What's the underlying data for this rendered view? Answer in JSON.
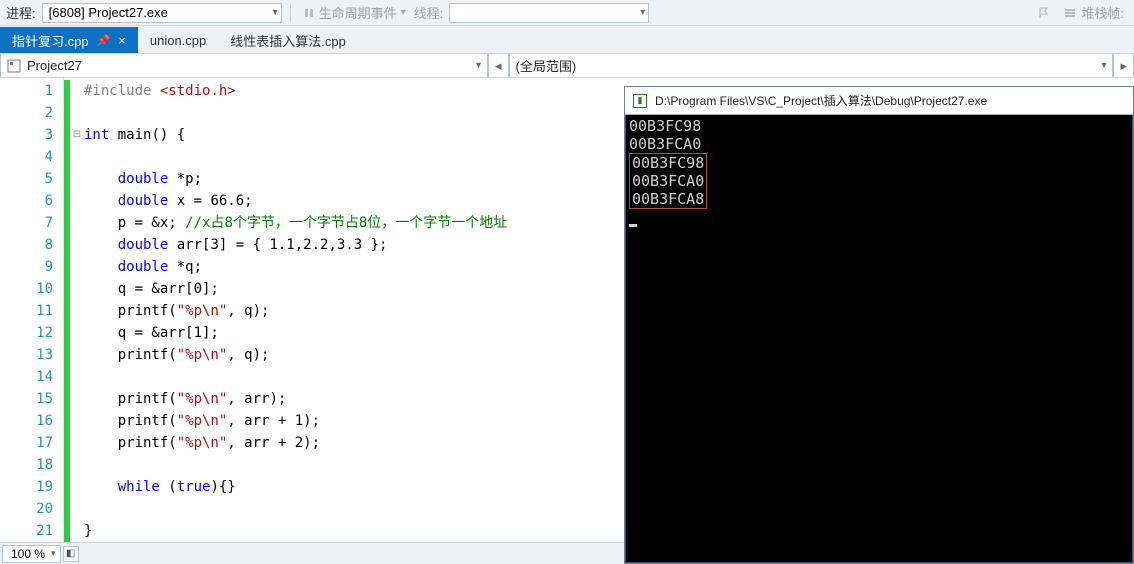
{
  "toolbar": {
    "process_label": "进程:",
    "process_value": "[6808] Project27.exe",
    "lifecycle": "生命周期事件",
    "thread_label": "线程:",
    "stack_label": "堆栈帧:"
  },
  "tabs": [
    {
      "label": "指针复习.cpp",
      "active": true
    },
    {
      "label": "union.cpp",
      "active": false
    },
    {
      "label": "线性表插入算法.cpp",
      "active": false
    }
  ],
  "crumb": {
    "left": "Project27",
    "right": "(全局范围)"
  },
  "code": {
    "lines": [
      {
        "n": 1,
        "html": "<span class='pre'>#include</span> <span class='hdr'>&lt;stdio.h&gt;</span>"
      },
      {
        "n": 2,
        "html": ""
      },
      {
        "n": 3,
        "html": "<span class='kw'>int</span> main() {",
        "fold": "⊟"
      },
      {
        "n": 4,
        "html": ""
      },
      {
        "n": 5,
        "html": "    <span class='kw'>double</span> *p;"
      },
      {
        "n": 6,
        "html": "    <span class='kw'>double</span> x = 66.6;"
      },
      {
        "n": 7,
        "html": "    p = &amp;x; <span class='cmt'>//x占8个字节，一个字节占8位，一个字节一个地址</span>"
      },
      {
        "n": 8,
        "html": "    <span class='kw'>double</span> arr[3] = { 1.1,2.2,3.3 };"
      },
      {
        "n": 9,
        "html": "    <span class='kw'>double</span> *q;"
      },
      {
        "n": 10,
        "html": "    q = &amp;arr[0];"
      },
      {
        "n": 11,
        "html": "    printf(<span class='hdr'>\"%p\\n\"</span>, q);"
      },
      {
        "n": 12,
        "html": "    q = &amp;arr[1];"
      },
      {
        "n": 13,
        "html": "    printf(<span class='hdr'>\"%p\\n\"</span>, q);"
      },
      {
        "n": 14,
        "html": ""
      },
      {
        "n": 15,
        "html": "    printf(<span class='hdr'>\"%p\\n\"</span>, arr);"
      },
      {
        "n": 16,
        "html": "    printf(<span class='hdr'>\"%p\\n\"</span>, arr + 1);"
      },
      {
        "n": 17,
        "html": "    printf(<span class='hdr'>\"%p\\n\"</span>, arr + 2);"
      },
      {
        "n": 18,
        "html": ""
      },
      {
        "n": 19,
        "html": "    <span class='kw'>while</span> (<span class='kw'>true</span>){}"
      },
      {
        "n": 20,
        "html": ""
      },
      {
        "n": 21,
        "html": "}"
      }
    ]
  },
  "console": {
    "title": "D:\\Program Files\\VS\\C_Project\\插入算法\\Debug\\Project27.exe",
    "plain": [
      "00B3FC98",
      "00B3FCA0"
    ],
    "boxed": [
      "00B3FC98",
      "00B3FCA0",
      "00B3FCA8"
    ]
  },
  "status": {
    "zoom": "100 %"
  }
}
